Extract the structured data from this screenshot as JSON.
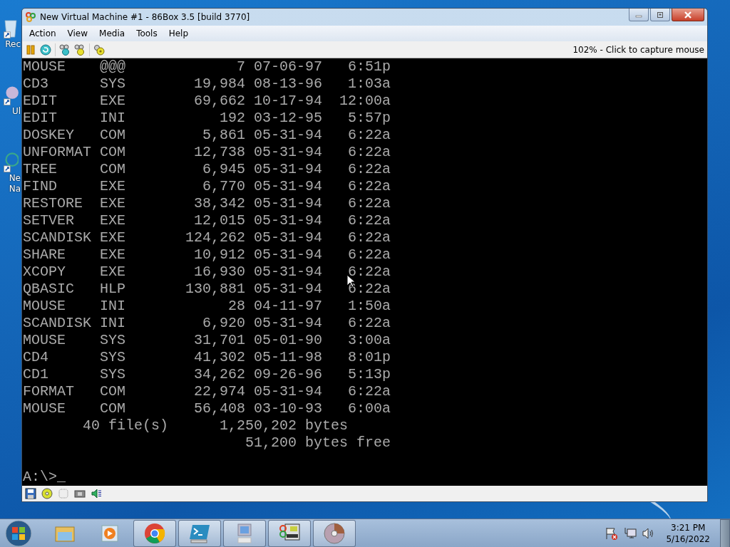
{
  "desktop": {
    "icons": [
      {
        "label_lines": [
          "Rec"
        ]
      },
      {
        "label_lines": [
          "Ul"
        ]
      },
      {
        "label_lines": [
          "Ne",
          "Na"
        ]
      }
    ]
  },
  "window": {
    "title": "New Virtual Machine #1 - 86Box 3.5 [build 3770]",
    "menu": [
      "Action",
      "View",
      "Media",
      "Tools",
      "Help"
    ],
    "toolbar_status": "102% - Click to capture mouse",
    "console": {
      "files": [
        {
          "name": "MOUSE",
          "ext": "@@@",
          "size": "7",
          "date": "07-06-97",
          "time": "6:51p"
        },
        {
          "name": "CD3",
          "ext": "SYS",
          "size": "19,984",
          "date": "08-13-96",
          "time": "1:03a"
        },
        {
          "name": "EDIT",
          "ext": "EXE",
          "size": "69,662",
          "date": "10-17-94",
          "time": "12:00a"
        },
        {
          "name": "EDIT",
          "ext": "INI",
          "size": "192",
          "date": "03-12-95",
          "time": "5:57p"
        },
        {
          "name": "DOSKEY",
          "ext": "COM",
          "size": "5,861",
          "date": "05-31-94",
          "time": "6:22a"
        },
        {
          "name": "UNFORMAT",
          "ext": "COM",
          "size": "12,738",
          "date": "05-31-94",
          "time": "6:22a"
        },
        {
          "name": "TREE",
          "ext": "COM",
          "size": "6,945",
          "date": "05-31-94",
          "time": "6:22a"
        },
        {
          "name": "FIND",
          "ext": "EXE",
          "size": "6,770",
          "date": "05-31-94",
          "time": "6:22a"
        },
        {
          "name": "RESTORE",
          "ext": "EXE",
          "size": "38,342",
          "date": "05-31-94",
          "time": "6:22a"
        },
        {
          "name": "SETVER",
          "ext": "EXE",
          "size": "12,015",
          "date": "05-31-94",
          "time": "6:22a"
        },
        {
          "name": "SCANDISK",
          "ext": "EXE",
          "size": "124,262",
          "date": "05-31-94",
          "time": "6:22a"
        },
        {
          "name": "SHARE",
          "ext": "EXE",
          "size": "10,912",
          "date": "05-31-94",
          "time": "6:22a"
        },
        {
          "name": "XCOPY",
          "ext": "EXE",
          "size": "16,930",
          "date": "05-31-94",
          "time": "6:22a"
        },
        {
          "name": "QBASIC",
          "ext": "HLP",
          "size": "130,881",
          "date": "05-31-94",
          "time": "6:22a"
        },
        {
          "name": "MOUSE",
          "ext": "INI",
          "size": "28",
          "date": "04-11-97",
          "time": "1:50a"
        },
        {
          "name": "SCANDISK",
          "ext": "INI",
          "size": "6,920",
          "date": "05-31-94",
          "time": "6:22a"
        },
        {
          "name": "MOUSE",
          "ext": "SYS",
          "size": "31,701",
          "date": "05-01-90",
          "time": "3:00a"
        },
        {
          "name": "CD4",
          "ext": "SYS",
          "size": "41,302",
          "date": "05-11-98",
          "time": "8:01p"
        },
        {
          "name": "CD1",
          "ext": "SYS",
          "size": "34,262",
          "date": "09-26-96",
          "time": "5:13p"
        },
        {
          "name": "FORMAT",
          "ext": "COM",
          "size": "22,974",
          "date": "05-31-94",
          "time": "6:22a"
        },
        {
          "name": "MOUSE",
          "ext": "COM",
          "size": "56,408",
          "date": "03-10-93",
          "time": "6:00a"
        }
      ],
      "file_count": "40 file(s)",
      "total_bytes": "1,250,202 bytes",
      "free_bytes": "51,200 bytes free",
      "prompt": "A:\\>_"
    }
  },
  "taskbar": {
    "apps": [
      {
        "running": false
      },
      {
        "running": false
      },
      {
        "running": true
      },
      {
        "running": true
      },
      {
        "running": true
      },
      {
        "running": true
      },
      {
        "running": true
      }
    ],
    "clock": {
      "time": "3:21 PM",
      "date": "5/16/2022"
    }
  }
}
